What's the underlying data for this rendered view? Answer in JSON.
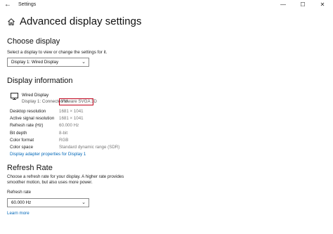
{
  "window": {
    "app_title": "Settings",
    "back_icon": "arrow-left-icon",
    "controls": {
      "minimize": "—",
      "maximize": "☐",
      "close": "✕"
    }
  },
  "page": {
    "title": "Advanced display settings",
    "icon": "home-icon"
  },
  "choose_display": {
    "heading": "Choose display",
    "description": "Select a display to view or change the settings for it.",
    "selected": "Display 1: Wired Display"
  },
  "display_information": {
    "heading": "Display information",
    "display_name": "Wired Display",
    "connection_prefix": "Display 1: Connected to",
    "adapter": "VMware SVGA 3D",
    "rows": [
      {
        "label": "Desktop resolution",
        "value": "1681 × 1041"
      },
      {
        "label": "Active signal resolution",
        "value": "1681 × 1041"
      },
      {
        "label": "Refresh rate (Hz)",
        "value": "60.000 Hz"
      },
      {
        "label": "Bit depth",
        "value": "8-bit"
      },
      {
        "label": "Color format",
        "value": "RGB"
      },
      {
        "label": "Color space",
        "value": "Standard dynamic range (SDR)"
      }
    ],
    "adapter_link": "Display adapter properties for Display 1"
  },
  "refresh_rate": {
    "heading": "Refresh Rate",
    "description_line1": "Choose a refresh rate for your display. A higher rate provides",
    "description_line2": "smoother motion, but also uses more power.",
    "field_label": "Refresh rate",
    "selected": "60.000 Hz",
    "learn_more": "Learn more"
  },
  "colors": {
    "accent": "#0067b8",
    "highlight": "#c0001a"
  }
}
